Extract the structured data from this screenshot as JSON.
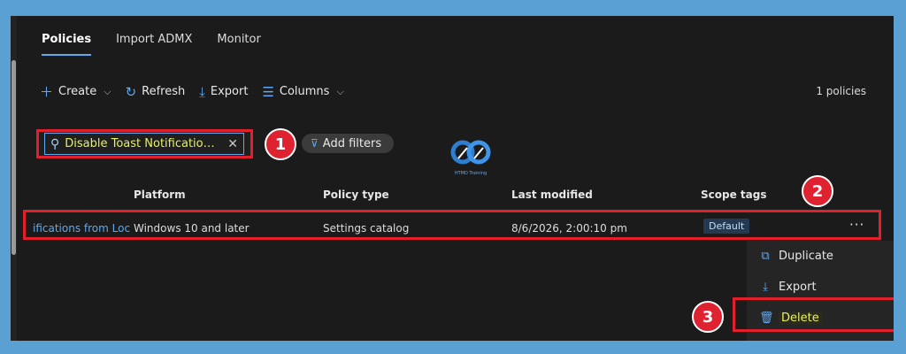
{
  "tabs": [
    {
      "label": "Policies",
      "active": true
    },
    {
      "label": "Import ADMX",
      "active": false
    },
    {
      "label": "Monitor",
      "active": false
    }
  ],
  "toolbar": {
    "create_label": "Create",
    "refresh_label": "Refresh",
    "export_label": "Export",
    "columns_label": "Columns",
    "count_label": "1 policies"
  },
  "search": {
    "value": "Disable Toast Notifications f..."
  },
  "filters": {
    "add_label": "Add filters"
  },
  "steps": [
    "1",
    "2",
    "3"
  ],
  "table": {
    "headers": {
      "platform": "Platform",
      "policy_type": "Policy type",
      "last_modified": "Last modified",
      "scope_tags": "Scope tags"
    },
    "row": {
      "name": "ifications from Loc",
      "platform": "Windows 10 and later",
      "policy_type": "Settings catalog",
      "last_modified": "8/6/2026, 2:00:10 pm",
      "scope_tag": "Default"
    }
  },
  "context_menu": {
    "duplicate_label": "Duplicate",
    "export_label": "Export",
    "delete_label": "Delete"
  },
  "logo": {
    "text": "HTMD Training"
  },
  "colors": {
    "accent": "#5ea9f0",
    "highlight_text": "#e7f25a",
    "annotation_red": "#e1202c",
    "background": "#1b1b1b"
  }
}
